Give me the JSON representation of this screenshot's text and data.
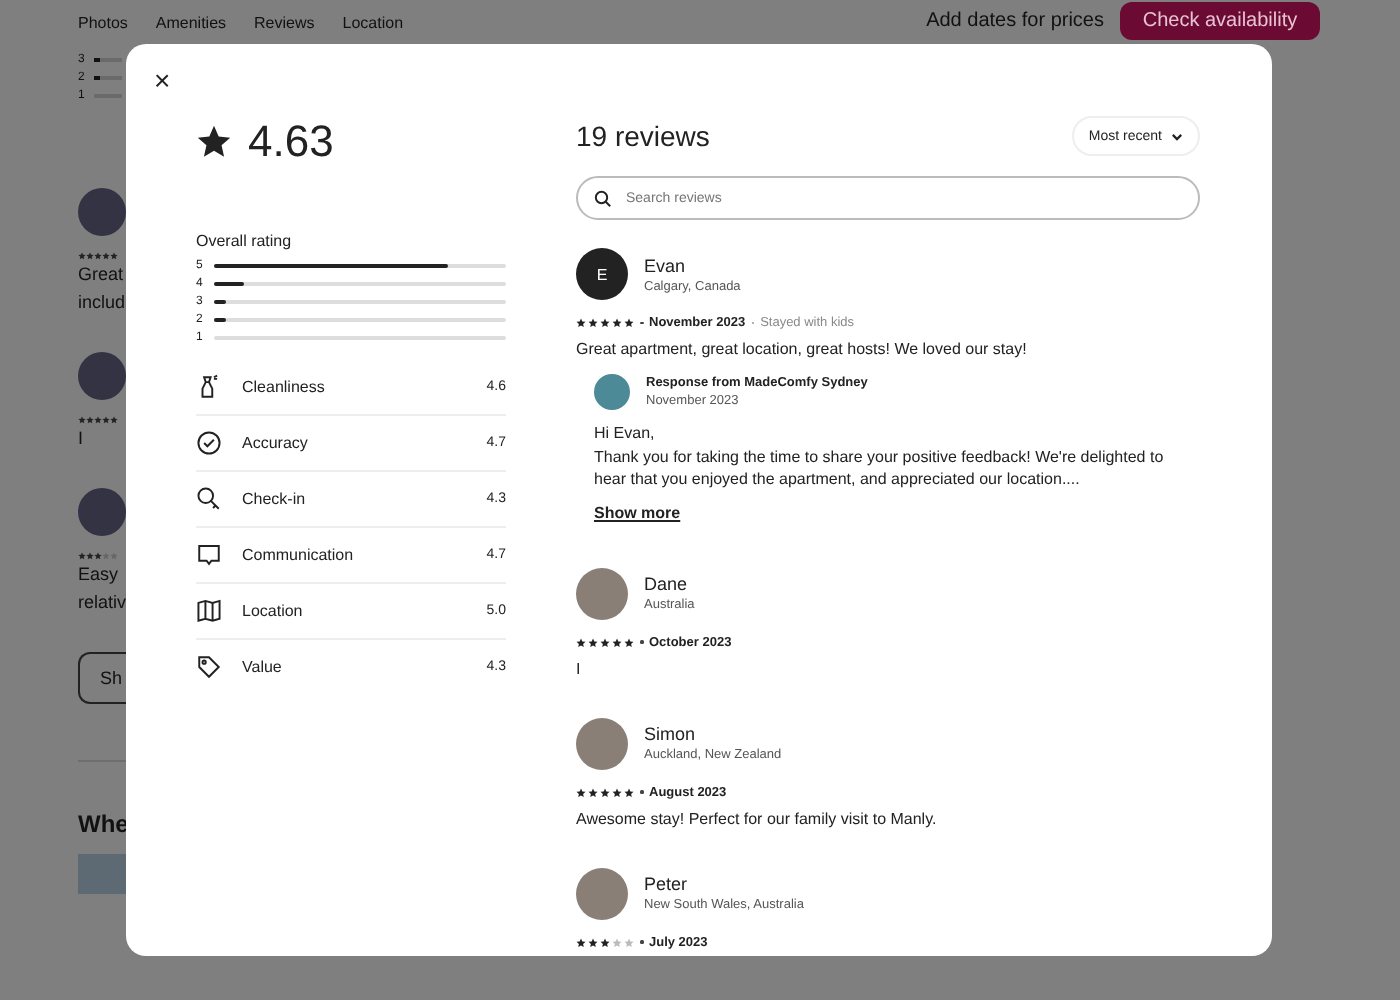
{
  "page": {
    "nav_tabs": [
      "Photos",
      "Amenities",
      "Reviews",
      "Location"
    ],
    "price_hint": "Add dates for prices",
    "check_button": "Check availability",
    "rating_bars": [
      {
        "label": "3",
        "level": 0.2
      },
      {
        "label": "2",
        "level": 0.2
      },
      {
        "label": "1"
      }
    ],
    "reviews": [
      {
        "stars": 5,
        "lines": [
          "Great",
          "includ"
        ]
      },
      {
        "stars": 5,
        "lines": [
          "I"
        ]
      },
      {
        "stars": 3,
        "lines": [
          "Easy",
          "relativ"
        ]
      }
    ],
    "show_button": "Sh",
    "section_heading": "Whe"
  },
  "modal": {
    "close": "×",
    "rating": "4.63",
    "overall_label": "Overall rating",
    "distribution": [
      {
        "label": "5",
        "level": 0.8
      },
      {
        "label": "4",
        "level": 0.1
      },
      {
        "label": "3",
        "level": 0.04
      },
      {
        "label": "2",
        "level": 0.04
      },
      {
        "label": "1"
      }
    ],
    "categories": [
      {
        "kind": "cleanliness",
        "label": "Cleanliness",
        "score": "4.6"
      },
      {
        "kind": "accuracy",
        "label": "Accuracy",
        "score": "4.7"
      },
      {
        "kind": "checkin",
        "label": "Check-in",
        "score": "4.3"
      },
      {
        "kind": "communication",
        "label": "Communication",
        "score": "4.7"
      },
      {
        "kind": "location",
        "label": "Location",
        "score": "5.0"
      },
      {
        "kind": "value",
        "label": "Value",
        "score": "4.3"
      }
    ],
    "reviews_title": "19 reviews",
    "sort": "Most recent",
    "search": {
      "placeholder": "Search reviews"
    },
    "reviews": [
      {
        "kind": "initial",
        "initial": "E",
        "name": "Evan",
        "location": "Calgary, Canada",
        "stars": 5,
        "date": "November 2023",
        "trip": "Stayed with kids",
        "text": "Great apartment, great location, great hosts! We loved our stay!",
        "response": {
          "title": "Response from MadeComfy Sydney",
          "date": "November 2023",
          "greeting": "Hi Evan,",
          "text": "Thank you for taking the time to share your positive feedback! We're delighted to hear that you enjoyed the apartment, and appreciated our location....",
          "more": "Show more"
        }
      },
      {
        "kind": "photo",
        "name": "Dane",
        "location": "Australia",
        "stars": 5,
        "date": "October 2023",
        "text": "I"
      },
      {
        "kind": "photo",
        "name": "Simon",
        "location": "Auckland, New Zealand",
        "stars": 5,
        "date": "August 2023",
        "text": "Awesome stay! Perfect for our family visit to Manly."
      },
      {
        "kind": "photo",
        "name": "Peter",
        "location": "New South Wales, Australia",
        "stars": 3,
        "date": "July 2023"
      }
    ]
  }
}
